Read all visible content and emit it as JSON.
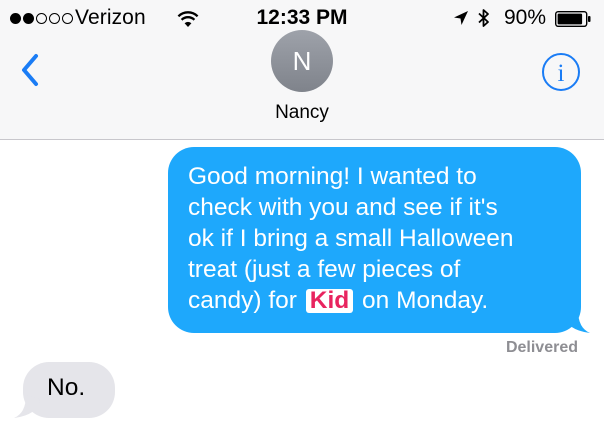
{
  "status_bar": {
    "carrier": "Verizon",
    "time": "12:33 PM",
    "battery_percent": "90%",
    "signal_bars_filled": 2,
    "signal_bars_total": 5,
    "battery_level": 0.9
  },
  "header": {
    "avatar_initial": "N",
    "contact_name": "Nancy"
  },
  "messages": [
    {
      "direction": "outgoing",
      "lines": [
        "Good morning! I wanted to",
        "check with you and see if it's",
        "ok if I bring a small Halloween",
        "treat (just a few pieces of"
      ],
      "last_line_before_tag": "candy) for",
      "tag": "Kid",
      "last_line_after_tag": "on Monday.",
      "status": "Delivered"
    },
    {
      "direction": "incoming",
      "text": "No."
    }
  ],
  "colors": {
    "outgoing_bubble": "#1ea8fc",
    "incoming_bubble": "#e5e5ea",
    "accent": "#1a7cf5",
    "tag_text": "#e8245f"
  },
  "icons": [
    "wifi-icon",
    "location-arrow-icon",
    "bluetooth-icon",
    "battery-icon",
    "back-chevron-icon",
    "info-icon"
  ]
}
